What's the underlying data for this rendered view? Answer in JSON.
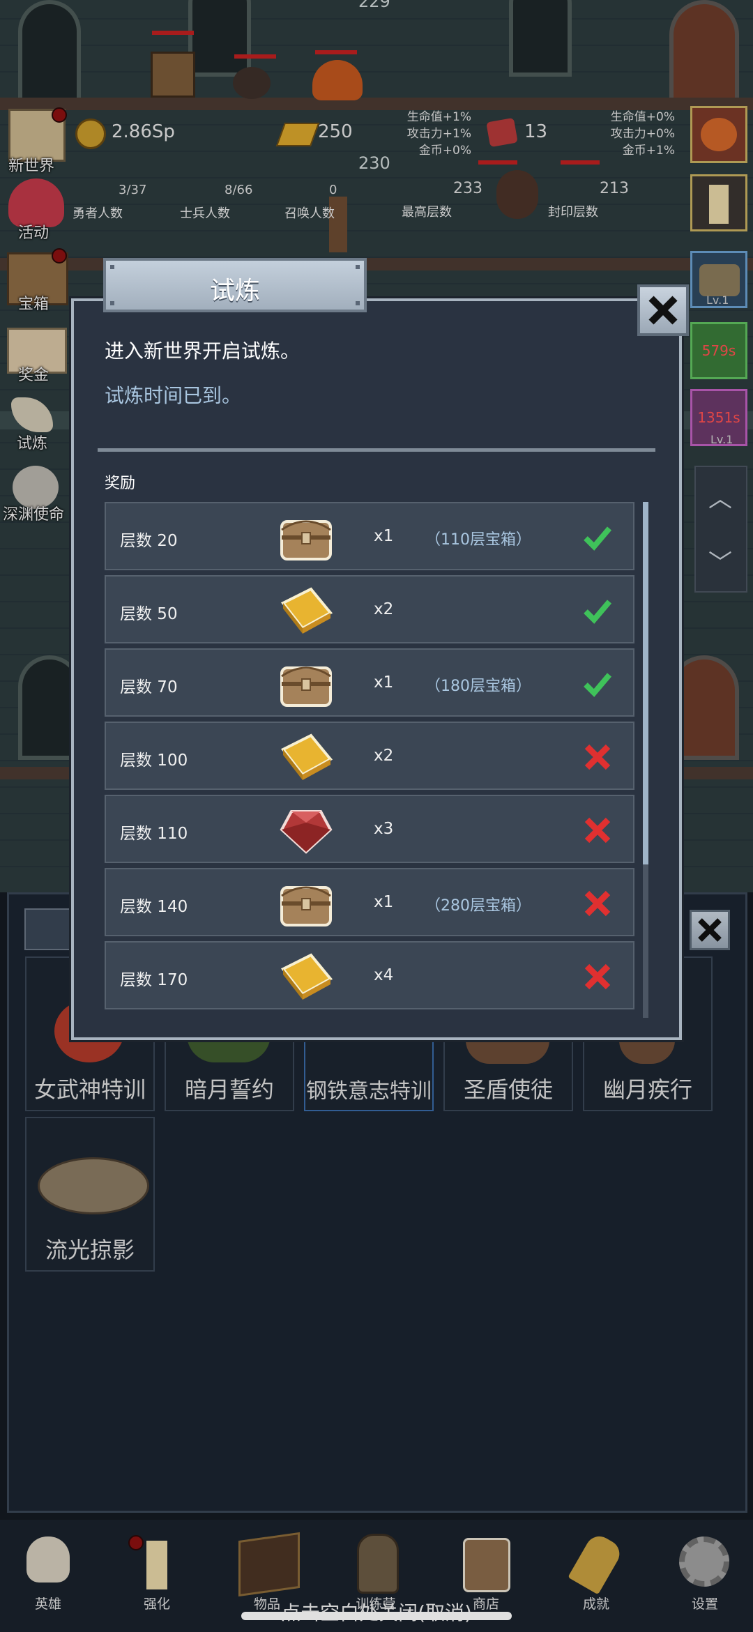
{
  "hud": {
    "coins": "2.86Sp",
    "gold_bars": "250",
    "gems": "13",
    "floor_top": "229",
    "floor_current": "230",
    "bonus_left": [
      "生命值+1%",
      "攻击力+1%",
      "金币+0%"
    ],
    "bonus_right": [
      "生命值+0%",
      "攻击力+0%",
      "金币+1%"
    ],
    "stats": [
      {
        "value": "3/37",
        "label": "勇者人数"
      },
      {
        "value": "8/66",
        "label": "士兵人数"
      },
      {
        "value": "0",
        "label": "召唤人数"
      },
      {
        "value": "233",
        "label": "最高层数"
      },
      {
        "value": "213",
        "label": "封印层数"
      }
    ],
    "right_timers": [
      "579s",
      "1351s"
    ],
    "right_labels": [
      "Lv.1",
      "Lv.1"
    ]
  },
  "side_menu": [
    "新世界",
    "活动",
    "宝箱",
    "奖金",
    "试炼",
    "深渊使命"
  ],
  "skills": [
    "女武神特训",
    "暗月誓约",
    "钢铁意志特训",
    "圣盾使徒",
    "幽月疾行",
    "流光掠影"
  ],
  "dialog": {
    "title": "试炼",
    "description": "进入新世界开启试炼。",
    "status_text": "试炼时间已到。",
    "rewards_label": "奖励",
    "rewards": [
      {
        "level": "层数 20",
        "item": "chest-icon",
        "qty": "x1",
        "note": "（110层宝箱）",
        "claimed": true
      },
      {
        "level": "层数 50",
        "item": "gold-bar-icon",
        "qty": "x2",
        "note": "",
        "claimed": true
      },
      {
        "level": "层数 70",
        "item": "chest-icon",
        "qty": "x1",
        "note": "（180层宝箱）",
        "claimed": true
      },
      {
        "level": "层数 100",
        "item": "gold-bar-icon",
        "qty": "x2",
        "note": "",
        "claimed": false
      },
      {
        "level": "层数 110",
        "item": "ruby-icon",
        "qty": "x3",
        "note": "",
        "claimed": false
      },
      {
        "level": "层数 140",
        "item": "chest-icon",
        "qty": "x1",
        "note": "（280层宝箱）",
        "claimed": false
      },
      {
        "level": "层数 170",
        "item": "gold-bar-icon",
        "qty": "x4",
        "note": "",
        "claimed": false
      }
    ]
  },
  "bottom_nav": [
    "英雄",
    "强化",
    "物品",
    "训练营",
    "商店",
    "成就",
    "设置"
  ],
  "close_tip": "点击空白处关闭(取消)",
  "colors": {
    "claimed": "#3fc25a",
    "unclaimed": "#e03030",
    "accent_text": "#a9c6e0"
  }
}
